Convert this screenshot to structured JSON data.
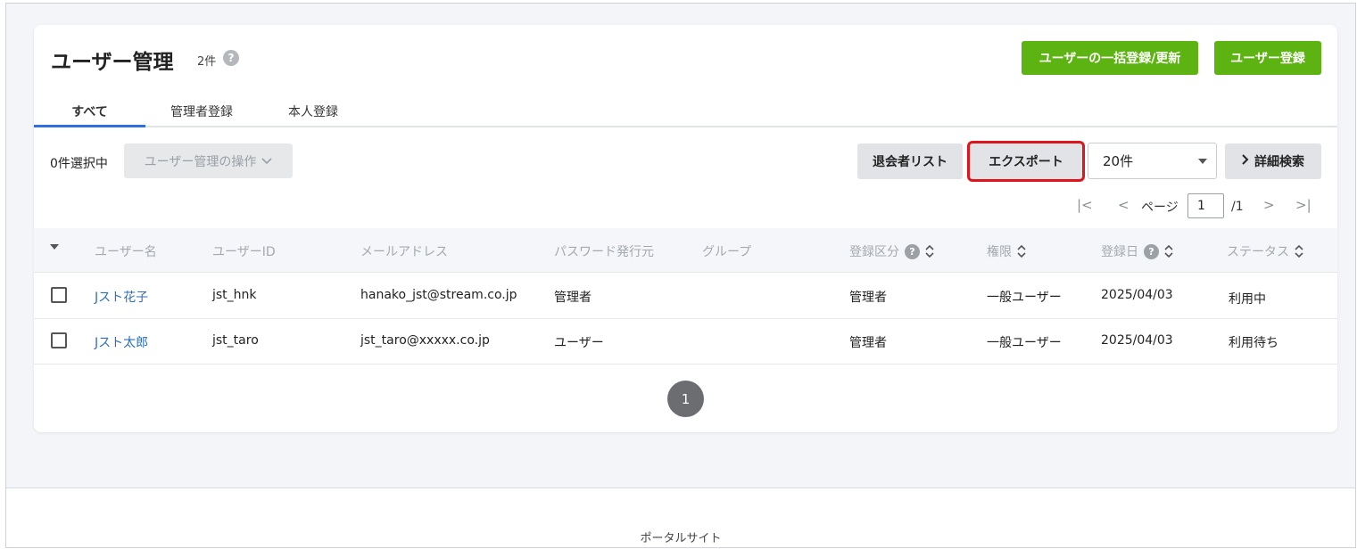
{
  "header": {
    "title": "ユーザー管理",
    "count": "2件",
    "help_icon": "question-circle-icon",
    "bulk_button": "ユーザーの一括登録/更新",
    "register_button": "ユーザー登録",
    "accent_green": "#5cb311"
  },
  "tabs": [
    {
      "label": "すべて",
      "active": true
    },
    {
      "label": "管理者登録",
      "active": false
    },
    {
      "label": "本人登録",
      "active": false
    }
  ],
  "toolbar": {
    "selected_count": "0件選択中",
    "operations_label": "ユーザー管理の操作",
    "withdrawn_list_label": "退会者リスト",
    "export_label": "エクスポート",
    "page_size_value": "20件",
    "detail_search_label": "詳細検索",
    "highlight_color": "#e0151b"
  },
  "pager": {
    "first_icon": "|<",
    "prev_icon": "<",
    "page_label": "ページ",
    "current_page": "1",
    "total_pages": "/1",
    "next_icon": ">",
    "last_icon": ">|"
  },
  "table": {
    "headers": {
      "username": "ユーザー名",
      "user_id": "ユーザーID",
      "email": "メールアドレス",
      "password_issuer": "パスワード発行元",
      "group": "グループ",
      "registration_type": "登録区分",
      "permission": "権限",
      "registered_date": "登録日",
      "status": "ステータス"
    },
    "rows": [
      {
        "username": "Jスト花子",
        "user_id": "jst_hnk",
        "email": "hanako_jst@stream.co.jp",
        "password_issuer": "管理者",
        "group": "",
        "registration_type": "管理者",
        "permission": "一般ユーザー",
        "registered_date": "2025/04/03",
        "status": "利用中"
      },
      {
        "username": "Jスト太郎",
        "user_id": "jst_taro",
        "email": "jst_taro@xxxxx.co.jp",
        "password_issuer": "ユーザー",
        "group": "",
        "registration_type": "管理者",
        "permission": "一般ユーザー",
        "registered_date": "2025/04/03",
        "status": "利用待ち"
      }
    ]
  },
  "pagination_bottom": {
    "page": "1"
  },
  "footer": {
    "link": "ポータルサイト"
  }
}
